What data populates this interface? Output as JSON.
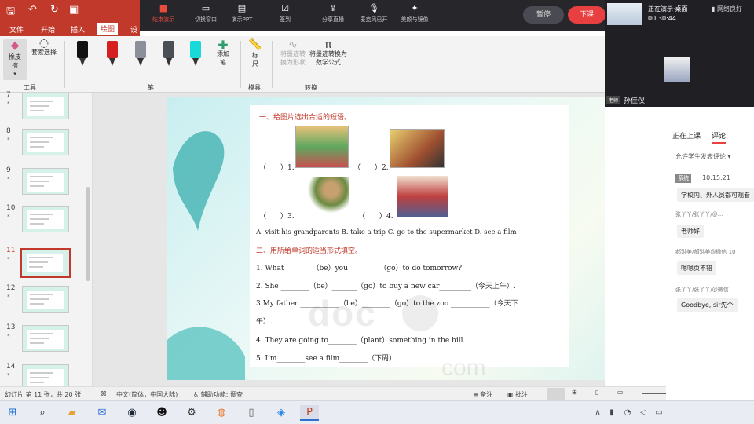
{
  "titlebar": {
    "save_icon": "save-icon",
    "undo_icon": "undo-icon",
    "redo_icon": "redo-icon",
    "format_icon": "format-painter-icon"
  },
  "menu": {
    "tabs": [
      "文件",
      "开始",
      "插入",
      "绘图",
      "设"
    ],
    "active_index": 3
  },
  "live_toolbar": {
    "items": [
      {
        "label": "结束演示",
        "icon": "stop-present-icon"
      },
      {
        "label": "切换窗口",
        "icon": "switch-window-icon"
      },
      {
        "label": "演示PPT",
        "icon": "ppt-icon"
      },
      {
        "label": "签到",
        "icon": "checkin-icon"
      },
      {
        "label": "分享直播",
        "icon": "share-icon"
      },
      {
        "label": "麦克风已开",
        "icon": "mic-icon"
      },
      {
        "label": "美颜与镜像",
        "icon": "beauty-icon"
      }
    ],
    "pause": "暂停",
    "next": "下课"
  },
  "ribbon": {
    "eraser": "橡皮擦",
    "lasso": "套索选择",
    "tools_group": "工具",
    "pens_group": "笔",
    "add_pen": "添加笔",
    "ruler": "标尺",
    "stencil_group": "模具",
    "ink_to_shape": "将墨迹转换为形状",
    "ink_to_math": "将墨迹转换为数学公式",
    "convert_group": "转换",
    "pen_colors": [
      "#111111",
      "#d42020",
      "#8a8f9a",
      "#4a4f55",
      "#19d9d9"
    ]
  },
  "thumbs": [
    {
      "num": "7",
      "star": "*"
    },
    {
      "num": "8",
      "star": "*"
    },
    {
      "num": "9",
      "star": "*"
    },
    {
      "num": "10",
      "star": "*"
    },
    {
      "num": "11",
      "star": "*",
      "active": true
    },
    {
      "num": "12",
      "star": "*"
    },
    {
      "num": "13",
      "star": "*"
    },
    {
      "num": "14",
      "star": "*"
    }
  ],
  "slide": {
    "heading1": "一、给图片选出合适的短语。",
    "bracket1": "（　　）1.",
    "bracket2": "（　　）2.",
    "bracket3": "（　　）3.",
    "bracket4": "（　　）4.",
    "options": "A. visit his grandparents   B. take a trip    C. go to the supermarket    D. see a film",
    "heading2": "二、用所给单词的适当形式填空。",
    "q1": "1. What________（be）you_________（go）to do tomorrow?",
    "q2": "2. She  ________（be）_______（go）to buy a new car_________（今天上午）.",
    "q3a": "3.My father ___________（be）________（go）to the zoo ___________（今天下",
    "q3b": "午）.",
    "q4": "4. They are going to________（plant）something in the hill.",
    "q5": "5. I’m________see a film________（下周）."
  },
  "presenter": {
    "status": "正在演示·桌面",
    "time": "00:30:44",
    "network": "网络良好",
    "role": "老师",
    "name": "孙佳仪"
  },
  "chat": {
    "tabs": [
      "正在上课",
      "评论"
    ],
    "allow": "允许学生发表评论",
    "system_tag": "系统",
    "system_time": "10:15:21",
    "messages": [
      {
        "name": "",
        "text": "学校内、外人员都可观看"
      },
      {
        "name": "张丫丫/张丫丫/@...",
        "text": "老师好"
      },
      {
        "name": "郝洪美/郝洪美@微信  10",
        "text": "嗯嗯页不错"
      },
      {
        "name": "张丫丫/张丫丫/@微信",
        "text": "Goodbye, sir先个"
      }
    ]
  },
  "statusbar": {
    "slide_info": "幻灯片 第 11 张，共 20 张",
    "language": "中文(简体，中国大陆)",
    "accessibility": "辅助功能: 调查",
    "notes": "备注",
    "comments": "批注"
  }
}
